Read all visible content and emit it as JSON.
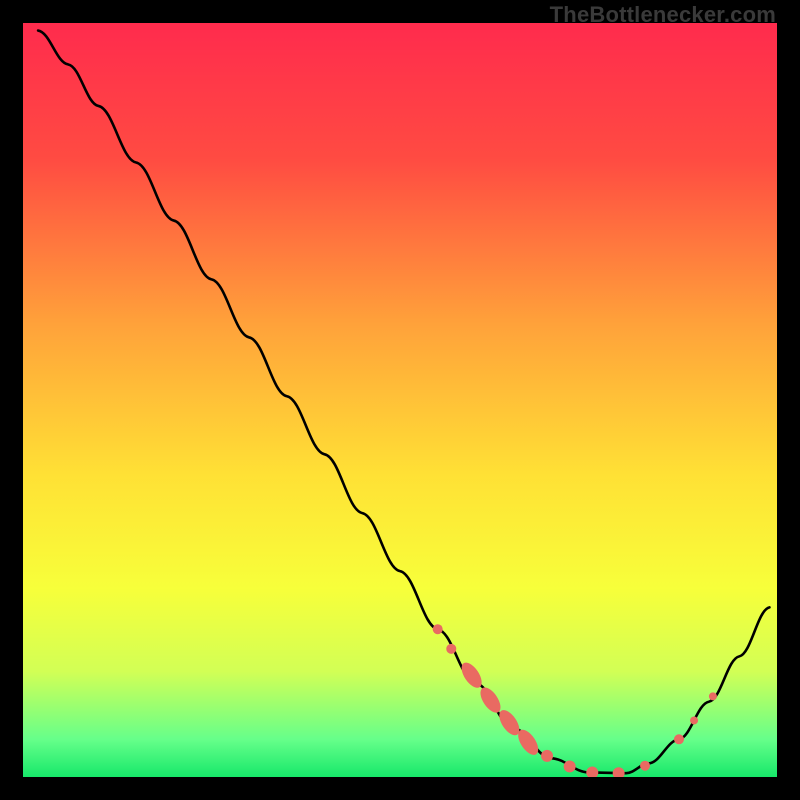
{
  "watermark": "TheBottlenecker.com",
  "chart_data": {
    "type": "line",
    "title": "",
    "xlabel": "",
    "ylabel": "",
    "xlim": [
      0,
      100
    ],
    "ylim": [
      0,
      100
    ],
    "background_gradient": {
      "stops": [
        {
          "offset": 0.0,
          "color": "#ff2b4d"
        },
        {
          "offset": 0.18,
          "color": "#ff4b42"
        },
        {
          "offset": 0.4,
          "color": "#ffa23a"
        },
        {
          "offset": 0.6,
          "color": "#ffe135"
        },
        {
          "offset": 0.75,
          "color": "#f7ff3a"
        },
        {
          "offset": 0.86,
          "color": "#d2ff55"
        },
        {
          "offset": 0.95,
          "color": "#66ff8a"
        },
        {
          "offset": 1.0,
          "color": "#17e86a"
        }
      ]
    },
    "curve": [
      {
        "x": 2.0,
        "y": 99.0
      },
      {
        "x": 6.0,
        "y": 94.5
      },
      {
        "x": 10.0,
        "y": 89.0
      },
      {
        "x": 15.0,
        "y": 81.5
      },
      {
        "x": 20.0,
        "y": 73.8
      },
      {
        "x": 25.0,
        "y": 66.0
      },
      {
        "x": 30.0,
        "y": 58.3
      },
      {
        "x": 35.0,
        "y": 50.5
      },
      {
        "x": 40.0,
        "y": 42.8
      },
      {
        "x": 45.0,
        "y": 35.0
      },
      {
        "x": 50.0,
        "y": 27.3
      },
      {
        "x": 55.0,
        "y": 19.6
      },
      {
        "x": 60.0,
        "y": 12.5
      },
      {
        "x": 65.0,
        "y": 6.5
      },
      {
        "x": 70.0,
        "y": 2.5
      },
      {
        "x": 75.0,
        "y": 0.6
      },
      {
        "x": 80.0,
        "y": 0.5
      },
      {
        "x": 83.0,
        "y": 1.8
      },
      {
        "x": 87.0,
        "y": 5.0
      },
      {
        "x": 91.0,
        "y": 10.0
      },
      {
        "x": 95.0,
        "y": 16.0
      },
      {
        "x": 99.0,
        "y": 22.5
      }
    ],
    "markers": [
      {
        "x": 55.0,
        "y": 19.6,
        "r": 5
      },
      {
        "x": 56.8,
        "y": 17.0,
        "r": 5
      },
      {
        "x": 59.5,
        "y": 13.5,
        "r": 8,
        "stretch": true
      },
      {
        "x": 62.0,
        "y": 10.2,
        "r": 8,
        "stretch": true
      },
      {
        "x": 64.5,
        "y": 7.2,
        "r": 8,
        "stretch": true
      },
      {
        "x": 67.0,
        "y": 4.6,
        "r": 8,
        "stretch": true
      },
      {
        "x": 69.5,
        "y": 2.8,
        "r": 6
      },
      {
        "x": 72.5,
        "y": 1.4,
        "r": 6
      },
      {
        "x": 75.5,
        "y": 0.6,
        "r": 6
      },
      {
        "x": 79.0,
        "y": 0.5,
        "r": 6
      },
      {
        "x": 82.5,
        "y": 1.5,
        "r": 5
      },
      {
        "x": 87.0,
        "y": 5.0,
        "r": 5
      },
      {
        "x": 89.0,
        "y": 7.5,
        "r": 4
      },
      {
        "x": 91.5,
        "y": 10.7,
        "r": 4
      }
    ],
    "marker_color": "#e96a62",
    "curve_color": "#000000"
  }
}
